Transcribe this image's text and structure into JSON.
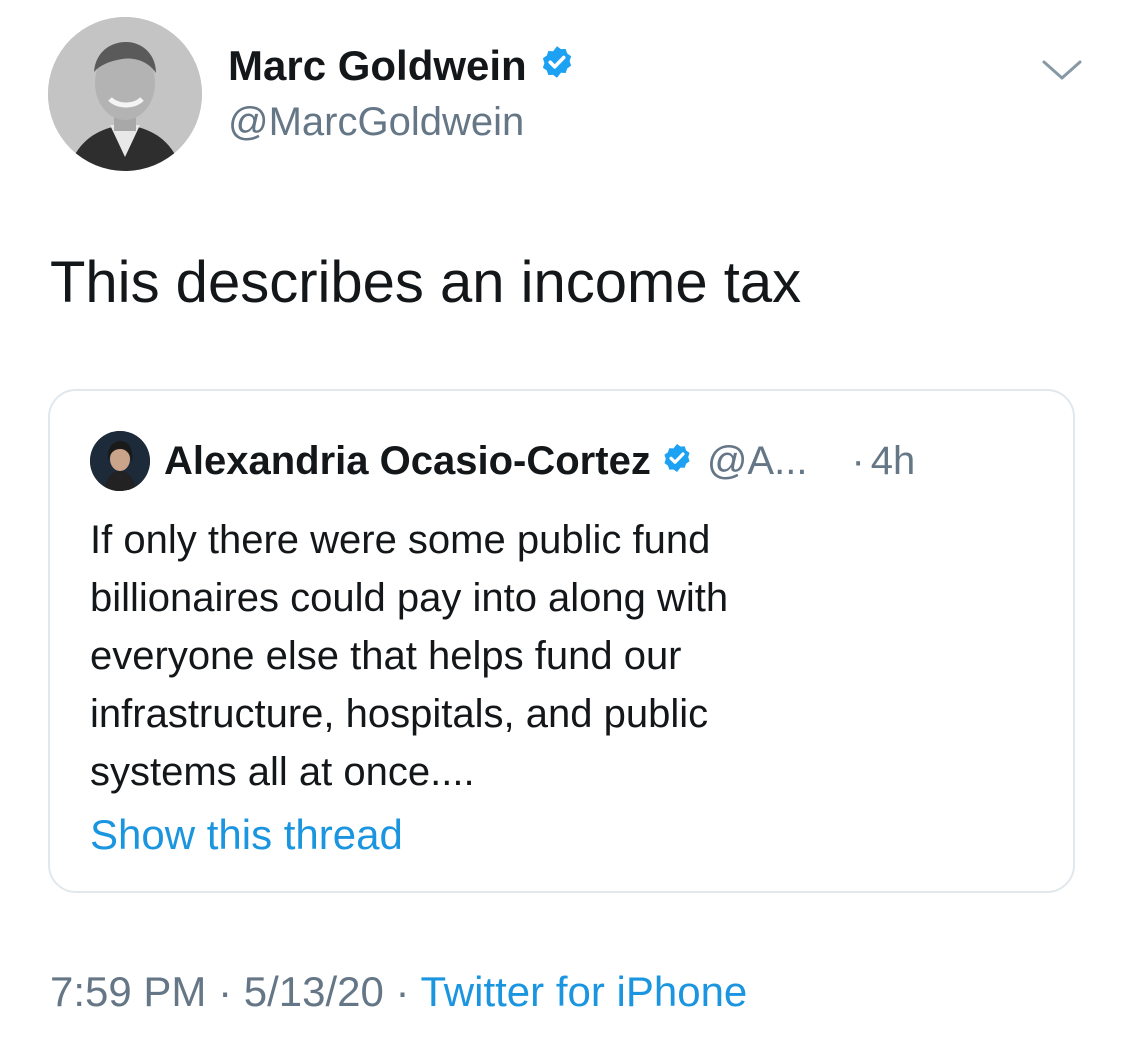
{
  "author": {
    "name": "Marc Goldwein",
    "handle": "@MarcGoldwein",
    "verified_icon": "verified-badge-icon",
    "avatar_icon": "profile-photo"
  },
  "menu": {
    "icon": "chevron-down-icon"
  },
  "tweet": {
    "text": "This describes an income tax"
  },
  "quoted_tweet": {
    "author_name": "Alexandria Ocasio-Cortez",
    "author_handle": "@A...",
    "separator": "·",
    "time": "4h",
    "lines": [
      "If only there were some public fund",
      "billionaires could pay into along with",
      "everyone else that helps fund our",
      "infrastructure, hospitals, and public",
      "systems all at once...."
    ],
    "show_thread": "Show this thread"
  },
  "meta": {
    "time": "7:59 PM",
    "sep1": " · ",
    "date": "5/13/20",
    "sep2": " · ",
    "source": "Twitter for iPhone"
  },
  "colors": {
    "link": "#1b95e0",
    "secondary": "#657786",
    "border": "#e1e8ed",
    "verified": "#1da1f2"
  }
}
